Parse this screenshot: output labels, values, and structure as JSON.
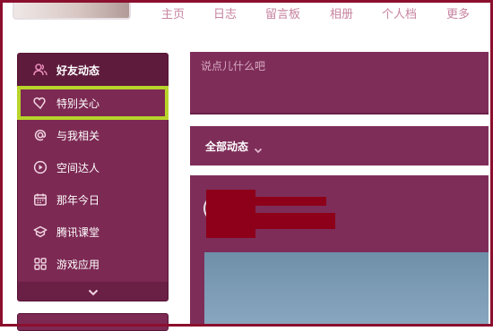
{
  "top_nav": [
    "主页",
    "日志",
    "留言板",
    "相册",
    "个人档",
    "更多"
  ],
  "sidebar": {
    "items": [
      {
        "label": "好友动态",
        "icon": "friends-icon",
        "active": true
      },
      {
        "label": "特别关心",
        "icon": "heart-icon",
        "highlighted": true
      },
      {
        "label": "与我相关",
        "icon": "at-icon"
      },
      {
        "label": "空间达人",
        "icon": "play-circle-icon"
      },
      {
        "label": "那年今日",
        "icon": "calendar-icon"
      },
      {
        "label": "腾讯课堂",
        "icon": "graduation-cap-icon"
      },
      {
        "label": "游戏应用",
        "icon": "grid-icon"
      }
    ],
    "expand_icon": "chevron-down-icon"
  },
  "post_box": {
    "placeholder": "说点儿什么吧"
  },
  "feed_filter": {
    "label": "全部动态",
    "icon": "chevron-down-icon"
  },
  "colors": {
    "panel": "#7e2d59",
    "sidebar": "#7c2953",
    "active_item": "#5e1b3c",
    "nav_text": "#c783a0",
    "highlight_outline": "#b8d42a",
    "frame": "#8b0f2e",
    "redaction": "#8e0019"
  }
}
